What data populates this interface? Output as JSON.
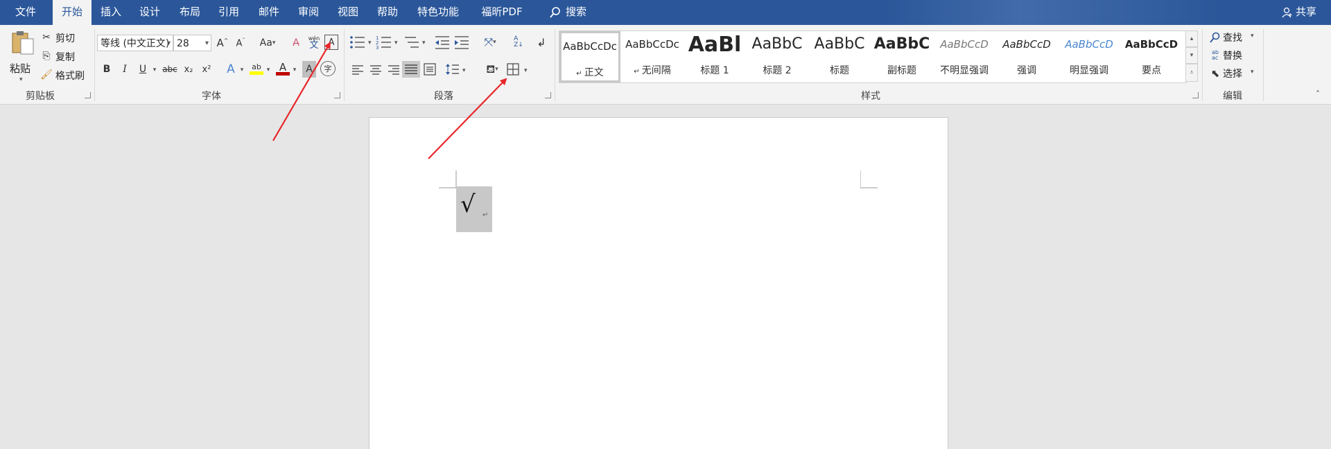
{
  "tabs": [
    {
      "label": "文件",
      "active": false
    },
    {
      "label": "开始",
      "active": true
    },
    {
      "label": "插入",
      "active": false
    },
    {
      "label": "设计",
      "active": false
    },
    {
      "label": "布局",
      "active": false
    },
    {
      "label": "引用",
      "active": false
    },
    {
      "label": "邮件",
      "active": false
    },
    {
      "label": "审阅",
      "active": false
    },
    {
      "label": "视图",
      "active": false
    },
    {
      "label": "帮助",
      "active": false
    },
    {
      "label": "特色功能",
      "active": false
    },
    {
      "label": "福昕PDF",
      "active": false
    }
  ],
  "search_label": "搜索",
  "share_label": "共享",
  "clipboard": {
    "paste": "粘贴",
    "cut": "剪切",
    "copy": "复制",
    "format_painter": "格式刷",
    "group_label": "剪贴板"
  },
  "font": {
    "font_name": "等线 (中文正文)",
    "font_size": "28",
    "group_label": "字体",
    "case_label": "Aa",
    "bold": "B",
    "italic": "I",
    "underline": "U",
    "strike": "abc",
    "subscript": "x₂",
    "superscript": "x²",
    "phonetic_top": "wén",
    "phonetic_bottom": "文",
    "char_border": "A",
    "font_color": "A",
    "highlight": "ab",
    "char_shade": "A",
    "enclose": "字"
  },
  "paragraph": {
    "group_label": "段落"
  },
  "styles": {
    "group_label": "样式",
    "items": [
      {
        "preview": "AaBbCcDc",
        "name": "正文",
        "selected": true
      },
      {
        "preview": "AaBbCcDc",
        "name": "无间隔",
        "selected": false
      },
      {
        "preview": "AaBl",
        "name": "标题 1",
        "selected": false
      },
      {
        "preview": "AaBbC",
        "name": "标题 2",
        "selected": false
      },
      {
        "preview": "AaBbC",
        "name": "标题",
        "selected": false
      },
      {
        "preview": "AaBbC",
        "name": "副标题",
        "selected": false
      },
      {
        "preview": "AaBbCcD",
        "name": "不明显强调",
        "selected": false
      },
      {
        "preview": "AaBbCcD",
        "name": "强调",
        "selected": false
      },
      {
        "preview": "AaBbCcD",
        "name": "明显强调",
        "selected": false
      },
      {
        "preview": "AaBbCcD",
        "name": "要点",
        "selected": false
      }
    ]
  },
  "editing": {
    "find": "查找",
    "replace": "替换",
    "select": "选择",
    "group_label": "编辑"
  },
  "document": {
    "content": "√",
    "paragraph_mark": "↵"
  },
  "colors": {
    "tab_bar": "#2b579a",
    "arrow": "#e8262a",
    "highlight_yellow": "#ffff00",
    "font_red": "#c00000"
  }
}
